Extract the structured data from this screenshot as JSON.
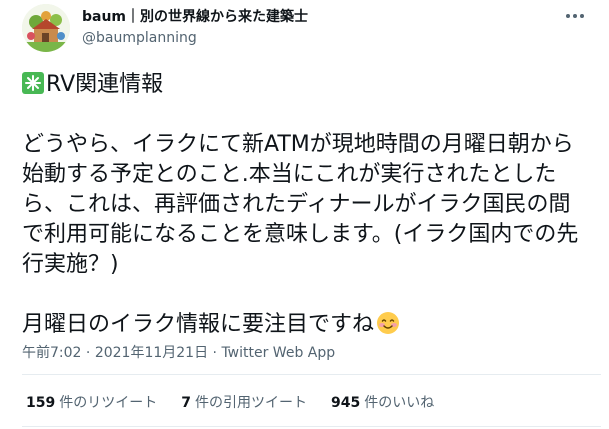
{
  "user": {
    "display_name": "baum｜別の世界線から来た建築士",
    "handle": "@baumplanning"
  },
  "tweet": {
    "heading": "RV関連情報",
    "paragraph1": "どうやら、イラクにて新ATMが現地時間の月曜日朝から始動する予定とのこと.本当にこれが実行されたとしたら、これは、再評価されたディナールがイラク国民の間で利用可能になることを意味します。(イラク国内での先行実施？)",
    "paragraph2": "月曜日のイラク情報に要注目ですね"
  },
  "meta": {
    "time": "午前7:02",
    "date": "2021年11月21日",
    "source": "Twitter Web App",
    "sep": " · "
  },
  "stats": {
    "retweets_count": "159",
    "retweets_label": "件のリツイート",
    "quotes_count": "7",
    "quotes_label": "件の引用ツイート",
    "likes_count": "945",
    "likes_label": "件のいいね"
  },
  "icons": {
    "avatar": "avatar-illustration",
    "more": "more-options-icon",
    "heading_emoji": "sparkle-emoji",
    "smile_emoji": "smiling-face-emoji"
  },
  "colors": {
    "text": "#0f1419",
    "secondary": "#536471",
    "divider": "#e6ecf0",
    "sparkle_bg": "#48b854"
  }
}
